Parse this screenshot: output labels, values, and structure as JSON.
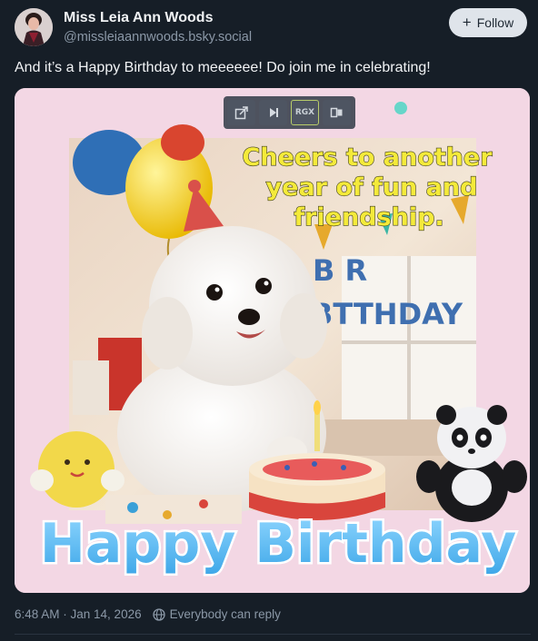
{
  "author": {
    "display_name": "Miss Leia Ann Woods",
    "handle": "@missleiaannwoods.bsky.social",
    "follow_label": "Follow"
  },
  "post": {
    "text": "And it’s a Happy Birthday to meeeeee!  Do join me in celebrating!",
    "timestamp": "6:48 AM · Jan 14, 2026",
    "reply_setting": "Everybody can reply"
  },
  "media": {
    "caption_lines": [
      "Cheers to another",
      "year of fun and",
      "friendship."
    ],
    "banner_letters_top": "B R",
    "banner_letters_bottom": "BTTHDAY",
    "big_text": "Happy Birthday",
    "controls": {
      "rgx_label": "RGX"
    }
  },
  "colors": {
    "background": "#161e27",
    "media_background": "#f3d7e4",
    "caption_yellow": "#f4ea3a",
    "big_text_blue": "#5ab8ef"
  }
}
